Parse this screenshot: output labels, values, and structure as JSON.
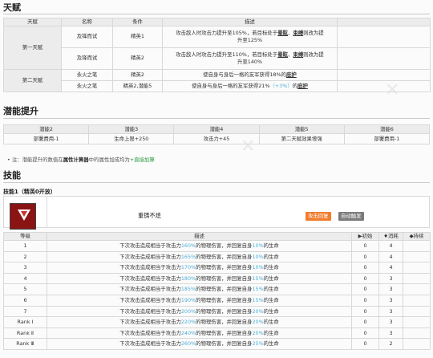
{
  "talent": {
    "section": "天赋",
    "headers": [
      "天赋",
      "名称",
      "条件",
      "描述"
    ],
    "first_label": "第一天赋",
    "second_label": "第二天赋",
    "rows": [
      {
        "name": "及锋而试",
        "cond": "精英1",
        "d1": "攻击敌人时攻击力提升至105%，若目标处于",
        "s1": "晕眩",
        "sep": "、",
        "s2": "束缚",
        "d2": "则改为提",
        "d3": "升至125%"
      },
      {
        "name": "及锋而试",
        "cond": "精英2",
        "d1": "攻击敌人时攻击力提升至110%，若目标处于",
        "s1": "晕眩",
        "sep": "、",
        "s2": "束缚",
        "d2": "则改为提",
        "d3": "升至140%"
      },
      {
        "name": "永火之笔",
        "cond": "精英2",
        "a": "使自身与身后一格的友军获得18%的",
        "u": "庇护"
      },
      {
        "name": "永火之笔",
        "cond": "精英2,潜能5",
        "a": "使自身与身后一格的友军获得21%",
        "b": "（+3%）",
        "c": "的",
        "u": "庇护"
      }
    ]
  },
  "potential": {
    "section": "潜能提升",
    "headers": [
      "潜能2",
      "潜能3",
      "潜能4",
      "潜能5",
      "潜能6"
    ],
    "values": [
      "部署费用-1",
      "生命上限+250",
      "攻击力+45",
      "第二天赋效果增强",
      "部署费用-1"
    ]
  },
  "note": {
    "pre": "注：潜能提升的数值在",
    "b": "属性计算器",
    "mid": "中的属性加成均为",
    "g": "+直接加算"
  },
  "skill": {
    "section": "技能",
    "title": "技能1（精英0开放）",
    "name": "重铸不熄",
    "tag_auto": "攻击回复",
    "tag_trigger": "自动触发",
    "headers": [
      "等级",
      "描述",
      "▶初始",
      "♦消耗",
      "◆持续"
    ],
    "desc_a": "下次攻击造成相当于攻击力",
    "desc_b": "的物理伤害，并回复自身",
    "desc_c": "的生命",
    "rows": [
      {
        "lv": "1",
        "p": "160%",
        "h": "10%",
        "init": "0",
        "cost": "4",
        "dur": ""
      },
      {
        "lv": "2",
        "p": "165%",
        "h": "10%",
        "init": "0",
        "cost": "4",
        "dur": ""
      },
      {
        "lv": "3",
        "p": "170%",
        "h": "10%",
        "init": "0",
        "cost": "4",
        "dur": ""
      },
      {
        "lv": "4",
        "p": "180%",
        "h": "15%",
        "init": "0",
        "cost": "3",
        "dur": ""
      },
      {
        "lv": "5",
        "p": "185%",
        "h": "15%",
        "init": "0",
        "cost": "3",
        "dur": ""
      },
      {
        "lv": "6",
        "p": "190%",
        "h": "15%",
        "init": "0",
        "cost": "3",
        "dur": ""
      },
      {
        "lv": "7",
        "p": "200%",
        "h": "20%",
        "init": "0",
        "cost": "3",
        "dur": ""
      },
      {
        "lv": "Rank Ⅰ",
        "p": "220%",
        "h": "20%",
        "init": "0",
        "cost": "3",
        "dur": ""
      },
      {
        "lv": "Rank Ⅱ",
        "p": "240%",
        "h": "20%",
        "init": "0",
        "cost": "3",
        "dur": ""
      },
      {
        "lv": "Rank Ⅲ",
        "p": "260%",
        "h": "25%",
        "init": "0",
        "cost": "2",
        "dur": ""
      }
    ]
  }
}
